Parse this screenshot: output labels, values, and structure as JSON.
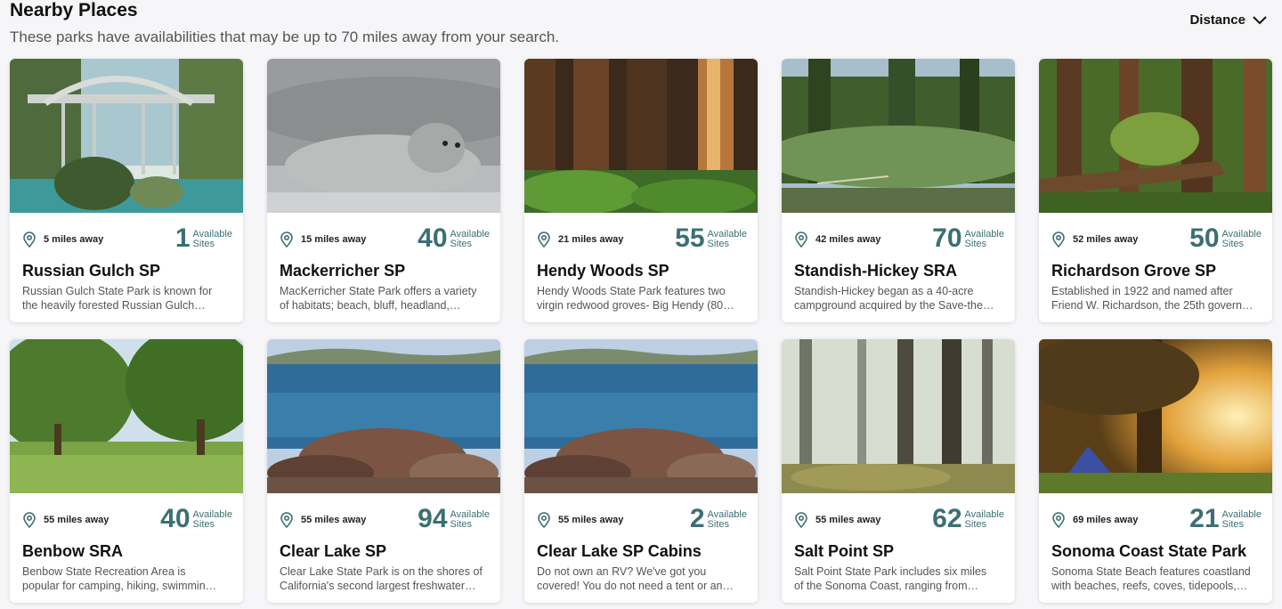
{
  "header": {
    "title": "Nearby Places",
    "subtitle": "These parks have availabilities that may be up to 70 miles away from your search.",
    "sort_label": "Distance"
  },
  "available_label_line1": "Available",
  "available_label_line2": "Sites",
  "icons": {
    "sort": "chevron-down-icon",
    "distance": "map-pin-icon"
  },
  "colors": {
    "accent": "#3c6f73",
    "background": "#f6f6f8",
    "card": "#ffffff"
  },
  "places": [
    {
      "distance": "5 miles away",
      "sites": "1",
      "name": "Russian Gulch SP",
      "desc_line1": "Russian Gulch State Park is known for",
      "desc_line2": "the heavily forested Russian Gulch…",
      "photo": "bridge"
    },
    {
      "distance": "15 miles away",
      "sites": "40",
      "name": "Mackerricher SP",
      "desc_line1": "MacKerricher State Park offers a variety",
      "desc_line2": "of habitats; beach, bluff, headland,…",
      "photo": "seal"
    },
    {
      "distance": "21 miles away",
      "sites": "55",
      "name": "Hendy Woods SP",
      "desc_line1": "Hendy Woods State Park features two",
      "desc_line2": "virgin redwood groves- Big Hendy (80…",
      "photo": "redwoods"
    },
    {
      "distance": "42 miles away",
      "sites": "70",
      "name": "Standish-Hickey SRA",
      "desc_line1": "Standish-Hickey began as a 40-acre",
      "desc_line2": "campground acquired by the Save-the…",
      "photo": "river"
    },
    {
      "distance": "52 miles away",
      "sites": "50",
      "name": "Richardson Grove SP",
      "desc_line1": "Established in 1922 and named after",
      "desc_line2": "Friend W. Richardson, the 25th govern…",
      "photo": "grove"
    },
    {
      "distance": "55 miles away",
      "sites": "40",
      "name": "Benbow SRA",
      "desc_line1": "Benbow State Recreation Area is",
      "desc_line2": "popular for camping, hiking, swimmin…",
      "photo": "meadow"
    },
    {
      "distance": "55 miles away",
      "sites": "94",
      "name": "Clear Lake SP",
      "desc_line1": "Clear Lake State Park is on the shores of",
      "desc_line2": "California's second largest freshwater…",
      "photo": "lake"
    },
    {
      "distance": "55 miles away",
      "sites": "2",
      "name": "Clear Lake SP Cabins",
      "desc_line1": "Do not own an RV? We've got you",
      "desc_line2": "covered! You do not need a tent or an…",
      "photo": "lake"
    },
    {
      "distance": "55 miles away",
      "sites": "62",
      "name": "Salt Point SP",
      "desc_line1": "Salt Point State Park includes six miles",
      "desc_line2": "of the Sonoma Coast, ranging from…",
      "photo": "fog"
    },
    {
      "distance": "69 miles away",
      "sites": "21",
      "name": "Sonoma Coast State Park",
      "desc_line1": "Sonoma State Beach features coastland",
      "desc_line2": "with beaches, reefs, coves, tidepools,…",
      "photo": "sunset"
    }
  ]
}
